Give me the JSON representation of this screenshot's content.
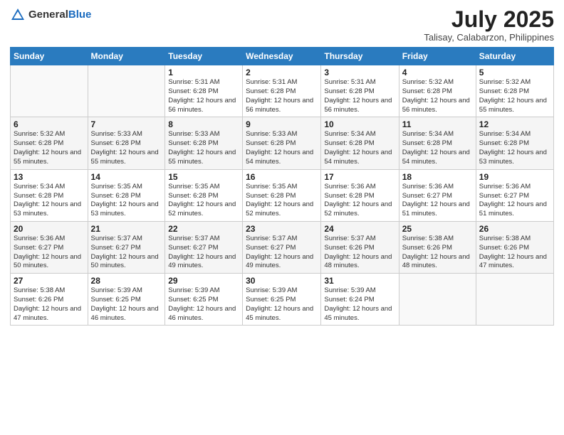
{
  "header": {
    "logo_general": "General",
    "logo_blue": "Blue",
    "main_title": "July 2025",
    "subtitle": "Talisay, Calabarzon, Philippines"
  },
  "weekdays": [
    "Sunday",
    "Monday",
    "Tuesday",
    "Wednesday",
    "Thursday",
    "Friday",
    "Saturday"
  ],
  "weeks": [
    [
      {
        "day": "",
        "info": ""
      },
      {
        "day": "",
        "info": ""
      },
      {
        "day": "1",
        "info": "Sunrise: 5:31 AM\nSunset: 6:28 PM\nDaylight: 12 hours and 56 minutes."
      },
      {
        "day": "2",
        "info": "Sunrise: 5:31 AM\nSunset: 6:28 PM\nDaylight: 12 hours and 56 minutes."
      },
      {
        "day": "3",
        "info": "Sunrise: 5:31 AM\nSunset: 6:28 PM\nDaylight: 12 hours and 56 minutes."
      },
      {
        "day": "4",
        "info": "Sunrise: 5:32 AM\nSunset: 6:28 PM\nDaylight: 12 hours and 56 minutes."
      },
      {
        "day": "5",
        "info": "Sunrise: 5:32 AM\nSunset: 6:28 PM\nDaylight: 12 hours and 55 minutes."
      }
    ],
    [
      {
        "day": "6",
        "info": "Sunrise: 5:32 AM\nSunset: 6:28 PM\nDaylight: 12 hours and 55 minutes."
      },
      {
        "day": "7",
        "info": "Sunrise: 5:33 AM\nSunset: 6:28 PM\nDaylight: 12 hours and 55 minutes."
      },
      {
        "day": "8",
        "info": "Sunrise: 5:33 AM\nSunset: 6:28 PM\nDaylight: 12 hours and 55 minutes."
      },
      {
        "day": "9",
        "info": "Sunrise: 5:33 AM\nSunset: 6:28 PM\nDaylight: 12 hours and 54 minutes."
      },
      {
        "day": "10",
        "info": "Sunrise: 5:34 AM\nSunset: 6:28 PM\nDaylight: 12 hours and 54 minutes."
      },
      {
        "day": "11",
        "info": "Sunrise: 5:34 AM\nSunset: 6:28 PM\nDaylight: 12 hours and 54 minutes."
      },
      {
        "day": "12",
        "info": "Sunrise: 5:34 AM\nSunset: 6:28 PM\nDaylight: 12 hours and 53 minutes."
      }
    ],
    [
      {
        "day": "13",
        "info": "Sunrise: 5:34 AM\nSunset: 6:28 PM\nDaylight: 12 hours and 53 minutes."
      },
      {
        "day": "14",
        "info": "Sunrise: 5:35 AM\nSunset: 6:28 PM\nDaylight: 12 hours and 53 minutes."
      },
      {
        "day": "15",
        "info": "Sunrise: 5:35 AM\nSunset: 6:28 PM\nDaylight: 12 hours and 52 minutes."
      },
      {
        "day": "16",
        "info": "Sunrise: 5:35 AM\nSunset: 6:28 PM\nDaylight: 12 hours and 52 minutes."
      },
      {
        "day": "17",
        "info": "Sunrise: 5:36 AM\nSunset: 6:28 PM\nDaylight: 12 hours and 52 minutes."
      },
      {
        "day": "18",
        "info": "Sunrise: 5:36 AM\nSunset: 6:27 PM\nDaylight: 12 hours and 51 minutes."
      },
      {
        "day": "19",
        "info": "Sunrise: 5:36 AM\nSunset: 6:27 PM\nDaylight: 12 hours and 51 minutes."
      }
    ],
    [
      {
        "day": "20",
        "info": "Sunrise: 5:36 AM\nSunset: 6:27 PM\nDaylight: 12 hours and 50 minutes."
      },
      {
        "day": "21",
        "info": "Sunrise: 5:37 AM\nSunset: 6:27 PM\nDaylight: 12 hours and 50 minutes."
      },
      {
        "day": "22",
        "info": "Sunrise: 5:37 AM\nSunset: 6:27 PM\nDaylight: 12 hours and 49 minutes."
      },
      {
        "day": "23",
        "info": "Sunrise: 5:37 AM\nSunset: 6:27 PM\nDaylight: 12 hours and 49 minutes."
      },
      {
        "day": "24",
        "info": "Sunrise: 5:37 AM\nSunset: 6:26 PM\nDaylight: 12 hours and 48 minutes."
      },
      {
        "day": "25",
        "info": "Sunrise: 5:38 AM\nSunset: 6:26 PM\nDaylight: 12 hours and 48 minutes."
      },
      {
        "day": "26",
        "info": "Sunrise: 5:38 AM\nSunset: 6:26 PM\nDaylight: 12 hours and 47 minutes."
      }
    ],
    [
      {
        "day": "27",
        "info": "Sunrise: 5:38 AM\nSunset: 6:26 PM\nDaylight: 12 hours and 47 minutes."
      },
      {
        "day": "28",
        "info": "Sunrise: 5:39 AM\nSunset: 6:25 PM\nDaylight: 12 hours and 46 minutes."
      },
      {
        "day": "29",
        "info": "Sunrise: 5:39 AM\nSunset: 6:25 PM\nDaylight: 12 hours and 46 minutes."
      },
      {
        "day": "30",
        "info": "Sunrise: 5:39 AM\nSunset: 6:25 PM\nDaylight: 12 hours and 45 minutes."
      },
      {
        "day": "31",
        "info": "Sunrise: 5:39 AM\nSunset: 6:24 PM\nDaylight: 12 hours and 45 minutes."
      },
      {
        "day": "",
        "info": ""
      },
      {
        "day": "",
        "info": ""
      }
    ]
  ]
}
